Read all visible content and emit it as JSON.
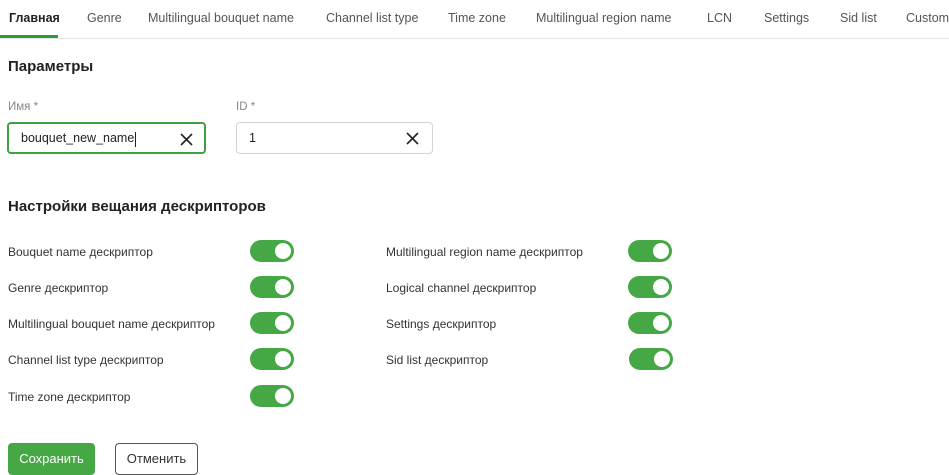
{
  "tabs": [
    {
      "label": "Главная",
      "active": true
    },
    {
      "label": "Genre"
    },
    {
      "label": "Multilingual bouquet name"
    },
    {
      "label": "Channel list type"
    },
    {
      "label": "Time zone"
    },
    {
      "label": "Multilingual region name"
    },
    {
      "label": "LCN"
    },
    {
      "label": "Settings"
    },
    {
      "label": "Sid list"
    },
    {
      "label": "Custom"
    }
  ],
  "params": {
    "title": "Параметры",
    "name_label": "Имя *",
    "name_value": "bouquet_new_name",
    "id_label": "ID *",
    "id_value": "1"
  },
  "descriptors": {
    "title": "Настройки вещания дескрипторов",
    "left": [
      {
        "label": "Bouquet name дескриптор",
        "enabled": true
      },
      {
        "label": "Genre дескриптор",
        "enabled": true
      },
      {
        "label": "Multilingual bouquet name дескриптор",
        "enabled": true
      },
      {
        "label": "Channel list type дескриптор",
        "enabled": true
      },
      {
        "label": "Time zone дескриптор",
        "enabled": true
      }
    ],
    "right": [
      {
        "label": "Multilingual region name дескриптор",
        "enabled": true
      },
      {
        "label": "Logical channel дескриптор",
        "enabled": true
      },
      {
        "label": "Settings дескриптор",
        "enabled": true
      },
      {
        "label": "Sid list дескриптор",
        "enabled": true
      }
    ]
  },
  "actions": {
    "save_label": "Сохранить",
    "cancel_label": "Отменить"
  },
  "colors": {
    "accent": "#45a845",
    "focus_border": "#3f9f43"
  }
}
